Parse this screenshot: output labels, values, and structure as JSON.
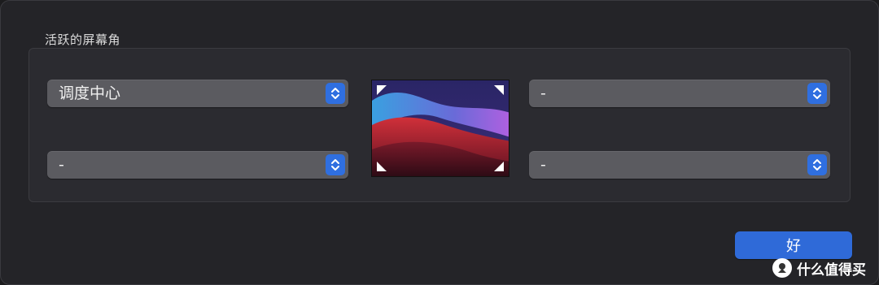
{
  "section": {
    "title": "活跃的屏幕角"
  },
  "corners": {
    "top_left": "调度中心",
    "top_right": "-",
    "bottom_left": "-",
    "bottom_right": "-"
  },
  "buttons": {
    "ok_label": "好"
  },
  "watermark": {
    "text": "什么值得买"
  },
  "icons": {
    "stepper": "chevron-up-down-icon",
    "corner": "corner-triangle-icon"
  },
  "colors": {
    "accent": "#2f6ad8",
    "popup_bg": "#5b5b60",
    "window_bg": "#242428"
  }
}
